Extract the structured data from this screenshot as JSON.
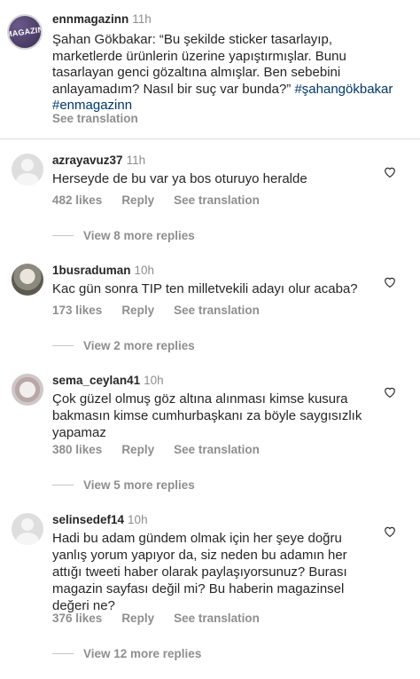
{
  "post": {
    "avatar_text": "MAGAZIN",
    "username": "ennmagazinn",
    "time": "11h",
    "caption_lines": [
      "Şahan Gökbakar: “Bu şekilde sticker tasarlayıp,",
      "marketlerde ürünlerin üzerine yapıştırmışlar. Bunu",
      "tasarlayan genci gözaltına almışlar. Ben sebebini",
      "anlayamadım? Nasıl bir suç var bunda?” "
    ],
    "hashtag1": "#şahangökbakar",
    "hashtag2": "#enmagazinn",
    "see_translation": "See translation"
  },
  "comments": [
    {
      "username": "azrayavuz37",
      "time": "11h",
      "text": "Herseyde de bu var ya bos oturuyo heralde",
      "likes": "482 likes",
      "reply": "Reply",
      "see_translation": "See translation",
      "view_replies": "View 8 more replies"
    },
    {
      "username": "1busraduman",
      "time": "10h",
      "text": "Kac gün sonra TIP ten milletvekili adayı olur acaba?",
      "likes": "173 likes",
      "reply": "Reply",
      "see_translation": "See translation",
      "view_replies": "View 2 more replies"
    },
    {
      "username": "sema_ceylan41",
      "time": "10h",
      "text": "Çok güzel olmuş göz altına alınması kimse kusura bakmasın kimse cumhurbaşkanı za böyle saygısızlık yapamaz",
      "likes": "380 likes",
      "reply": "Reply",
      "see_translation": "See translation",
      "view_replies": "View 5 more replies"
    },
    {
      "username": "selinsedef14",
      "time": "10h",
      "text": "Hadi bu adam gündem olmak için her şeye doğru yanlış yorum yapıyor da, siz neden bu adamın her attığı tweeti haber olarak paylaşıyorsunuz? Burası magazin sayfası değil mi? Bu haberin magazinsel değeri ne?",
      "likes": "376 likes",
      "reply": "Reply",
      "see_translation": "See translation",
      "view_replies": "View 12 more replies"
    }
  ],
  "colors": {
    "text": "#262626",
    "secondary": "#8e8e8e",
    "hashtag": "#00376b",
    "divider": "#dbdbdb"
  }
}
